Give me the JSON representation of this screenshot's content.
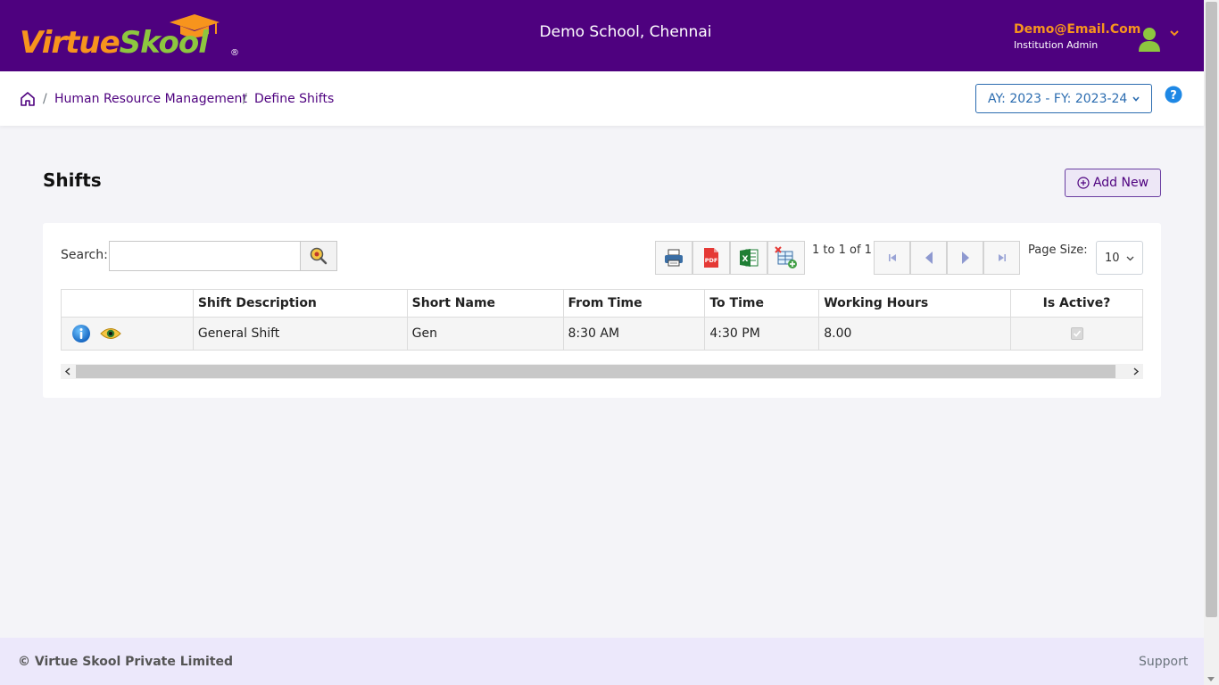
{
  "header": {
    "logo_part1": "Virtue",
    "logo_part2": "Skool",
    "logo_reg": "®",
    "school_name": "Demo School, Chennai",
    "user_email": "Demo@Email.Com",
    "user_role": "Institution Admin"
  },
  "breadcrumb": {
    "items": [
      "Human Resource Management",
      "Define Shifts"
    ],
    "separator": "/"
  },
  "year_selector": {
    "value": "AY: 2023 - FY: 2023-24"
  },
  "page": {
    "title": "Shifts",
    "add_label": "Add New"
  },
  "toolbar": {
    "search_label": "Search:",
    "search_value": "",
    "paging_text": "1 to 1 of 1",
    "page_size_label": "Page Size:",
    "page_size_value": "10"
  },
  "grid": {
    "columns": [
      "",
      "Shift Description",
      "Short Name",
      "From Time",
      "To Time",
      "Working Hours",
      "Is Active?"
    ],
    "rows": [
      {
        "shift_description": "General Shift",
        "short_name": "Gen",
        "from_time": "8:30 AM",
        "to_time": "4:30 PM",
        "working_hours": "8.00",
        "is_active": true
      }
    ]
  },
  "footer": {
    "copyright": "© Virtue Skool Private Limited",
    "support": "Support"
  },
  "colors": {
    "brand_purple": "#4e017f",
    "logo_orange": "#f7941d",
    "logo_green": "#8dc63f",
    "link_blue": "#2b6cb0",
    "footer_bg": "#ece8fb"
  },
  "icons": [
    "graduation-cap-icon",
    "user-avatar-icon",
    "chevron-down-icon",
    "home-icon",
    "help-icon",
    "plus-circle-icon",
    "search-icon",
    "print-icon",
    "pdf-icon",
    "excel-icon",
    "column-chooser-icon",
    "first-page-icon",
    "prev-page-icon",
    "next-page-icon",
    "last-page-icon",
    "info-icon",
    "view-icon",
    "checkbox-checked-icon"
  ]
}
